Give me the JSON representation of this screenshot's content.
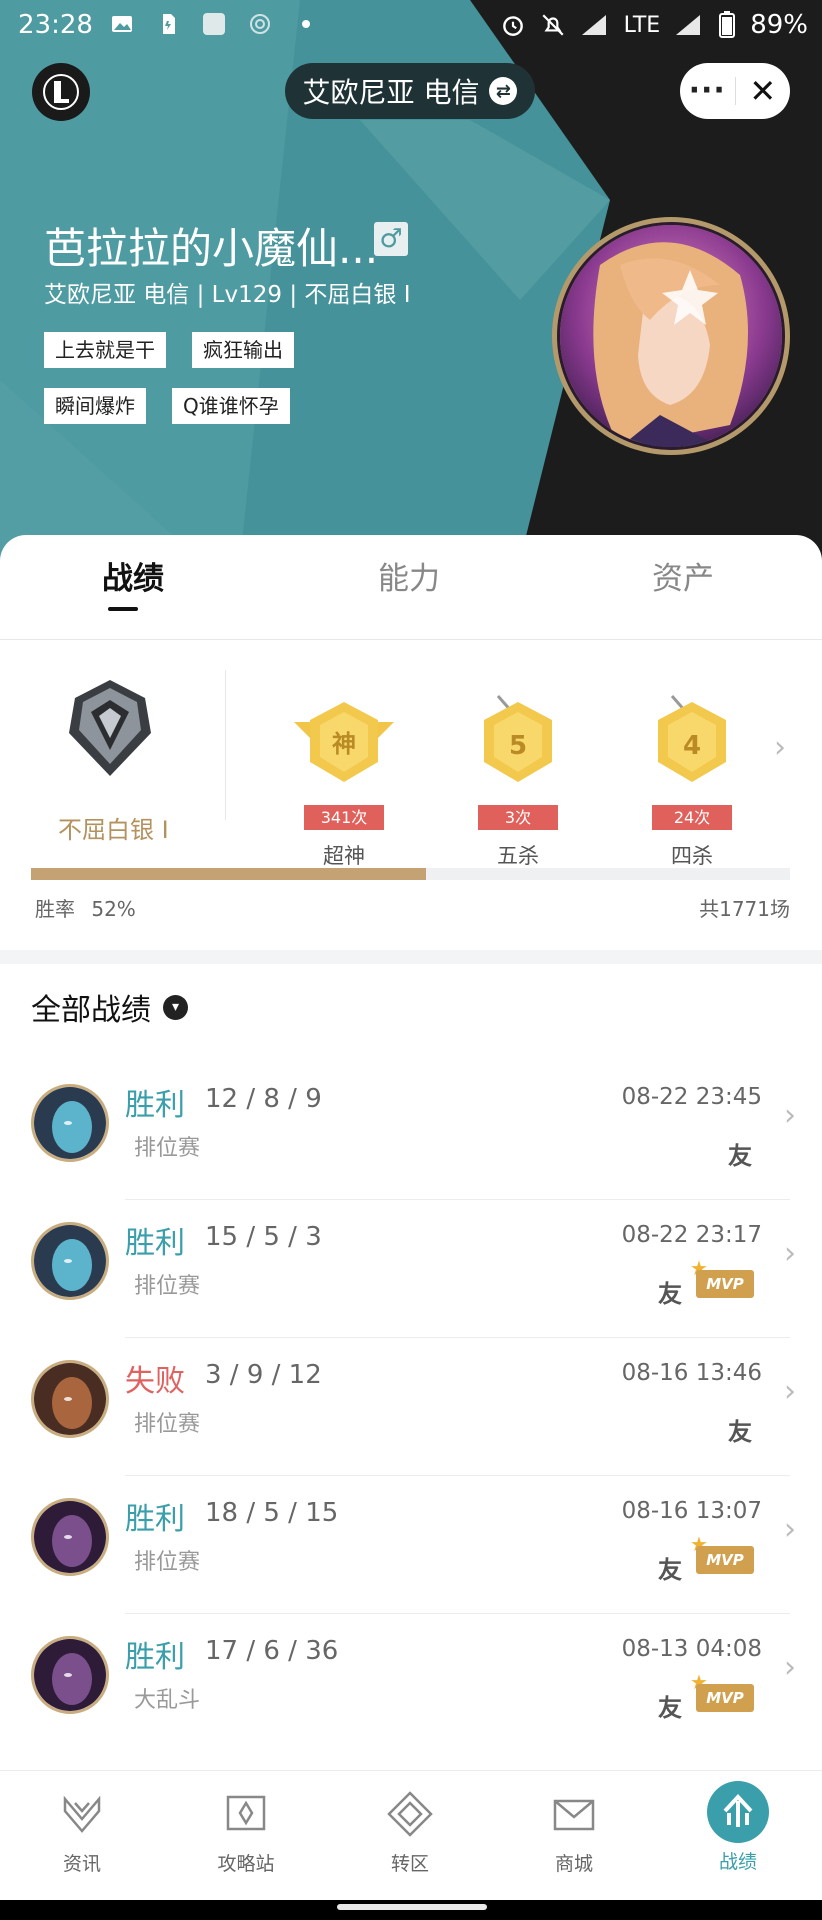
{
  "status_bar": {
    "time": "23:28",
    "network": "LTE",
    "battery": "89%"
  },
  "header": {
    "server_switch": "艾欧尼亚 电信",
    "player_name": "芭拉拉的小魔仙...",
    "gender_icon": "male-icon",
    "player_info": "艾欧尼亚 电信 | Lv129 | 不屈白银 I",
    "tags": [
      "上去就是干",
      "疯狂输出",
      "瞬间爆炸",
      "Q谁谁怀孕"
    ]
  },
  "tabs": [
    {
      "label": "战绩",
      "active": true
    },
    {
      "label": "能力",
      "active": false
    },
    {
      "label": "资产",
      "active": false
    }
  ],
  "rank": {
    "name": "不屈白银 I",
    "badges": [
      {
        "glyph": "神",
        "count": "341次",
        "label": "超神"
      },
      {
        "glyph": "5",
        "count": "3次",
        "label": "五杀"
      },
      {
        "glyph": "4",
        "count": "24次",
        "label": "四杀"
      }
    ],
    "win_rate_label": "胜率",
    "win_rate": "52%",
    "win_rate_value": 0.52,
    "total": "共1771场"
  },
  "matches_filter": "全部战绩",
  "matches": [
    {
      "result": "胜利",
      "kda": "12 / 8 / 9",
      "mode": "排位赛",
      "time": "08-22 23:45",
      "friend": "友",
      "mvp": false,
      "win": true
    },
    {
      "result": "胜利",
      "kda": "15 / 5 / 3",
      "mode": "排位赛",
      "time": "08-22 23:17",
      "friend": "友",
      "mvp": true,
      "win": true
    },
    {
      "result": "失败",
      "kda": "3 / 9 / 12",
      "mode": "排位赛",
      "time": "08-16 13:46",
      "friend": "友",
      "mvp": false,
      "win": false
    },
    {
      "result": "胜利",
      "kda": "18 / 5 / 15",
      "mode": "排位赛",
      "time": "08-16 13:07",
      "friend": "友",
      "mvp": true,
      "win": true
    },
    {
      "result": "胜利",
      "kda": "17 / 6 / 36",
      "mode": "大乱斗",
      "time": "08-13 04:08",
      "friend": "友",
      "mvp": true,
      "win": true
    }
  ],
  "mvp_label": "MVP",
  "bottom_nav": [
    {
      "label": "资讯",
      "active": false
    },
    {
      "label": "攻略站",
      "active": false
    },
    {
      "label": "转区",
      "active": false
    },
    {
      "label": "商城",
      "active": false
    },
    {
      "label": "战绩",
      "active": true
    }
  ],
  "colors": {
    "accent": "#3a9fab",
    "loss": "#e06260",
    "gold": "#c4a273",
    "header_bg": "#4d9aa1"
  }
}
